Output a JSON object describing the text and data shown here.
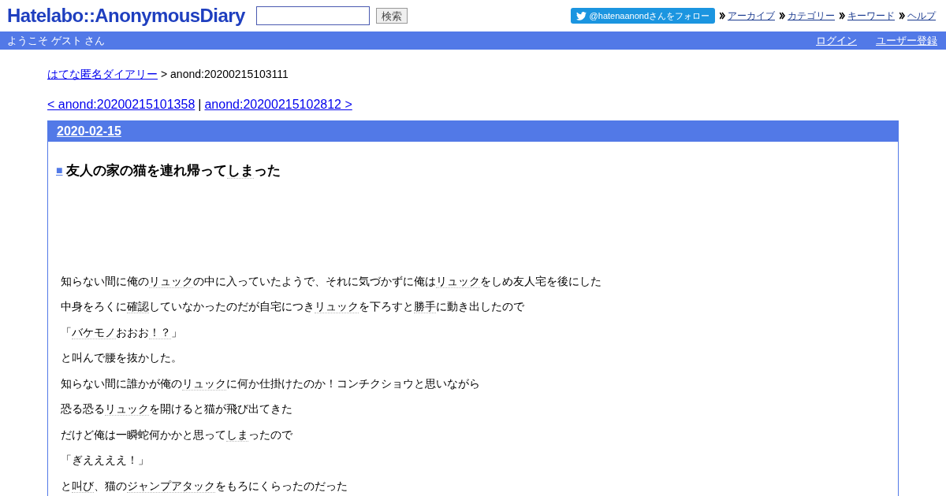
{
  "header": {
    "logo": "Hatelabo::AnonymousDiary",
    "search_button": "検索",
    "follow_button": "@hatenaanondさんをフォロー",
    "nav_links": [
      "アーカイブ",
      "カテゴリー",
      "キーワード",
      "ヘルプ"
    ]
  },
  "user_bar": {
    "welcome": "ようこそ ゲスト さん",
    "links": [
      "ログイン",
      "ユーザー登録"
    ]
  },
  "breadcrumb": {
    "link": "はてな匿名ダイアリー",
    "current": "> anond:20200215103111"
  },
  "pager": {
    "prev": "< anond:20200215101358",
    "separator": "|",
    "next": "anond:20200215102812 >"
  },
  "day": {
    "date": "2020-02-15",
    "entry": {
      "bullet": "■",
      "title": [
        {
          "text": "友人の家の猫を連れ帰って",
          "keyword": false
        },
        {
          "text": "しま",
          "keyword": true
        },
        {
          "text": "った",
          "keyword": false
        }
      ],
      "paragraphs": [
        [
          {
            "text": "知らない間に俺の",
            "keyword": false
          },
          {
            "text": "リュック",
            "keyword": true
          },
          {
            "text": "の中に入っていたようで、それに気づかずに俺は",
            "keyword": false
          },
          {
            "text": "リュック",
            "keyword": true
          },
          {
            "text": "をしめ友人宅を後にした",
            "keyword": false
          }
        ],
        [
          {
            "text": "中身をろくに",
            "keyword": false
          },
          {
            "text": "確認",
            "keyword": true
          },
          {
            "text": "していなかったのだが自宅につき",
            "keyword": false
          },
          {
            "text": "リュック",
            "keyword": true
          },
          {
            "text": "を下ろすと",
            "keyword": false
          },
          {
            "text": "勝手",
            "keyword": true
          },
          {
            "text": "に動き出したので",
            "keyword": false
          }
        ],
        [
          {
            "text": "「",
            "keyword": false
          },
          {
            "text": "バケモノ",
            "keyword": true
          },
          {
            "text": "おおお",
            "keyword": false
          },
          {
            "text": "！？",
            "keyword": true
          },
          {
            "text": "」",
            "keyword": false
          }
        ],
        [
          {
            "text": "と叫んで腰を抜かした。",
            "keyword": false
          }
        ],
        [
          {
            "text": "知らない間に誰かが俺の",
            "keyword": false
          },
          {
            "text": "リュック",
            "keyword": true
          },
          {
            "text": "に何か仕掛けたのか！コンチクショウと思いながら",
            "keyword": false
          }
        ],
        [
          {
            "text": "恐る恐る",
            "keyword": false
          },
          {
            "text": "リュック",
            "keyword": true
          },
          {
            "text": "を開けると猫が飛び出てきた",
            "keyword": false
          }
        ],
        [
          {
            "text": "だけど俺は一瞬蛇何かかと思って",
            "keyword": false
          },
          {
            "text": "しま",
            "keyword": true
          },
          {
            "text": "ったので",
            "keyword": false
          }
        ],
        [
          {
            "text": "「ぎええええ！」",
            "keyword": false
          }
        ],
        [
          {
            "text": "と",
            "keyword": false
          },
          {
            "text": "叫び",
            "keyword": true
          },
          {
            "text": "、猫の",
            "keyword": false
          },
          {
            "text": "ジャンプアタック",
            "keyword": true
          },
          {
            "text": "をもろにくらったのだった",
            "keyword": false
          }
        ]
      ]
    }
  }
}
